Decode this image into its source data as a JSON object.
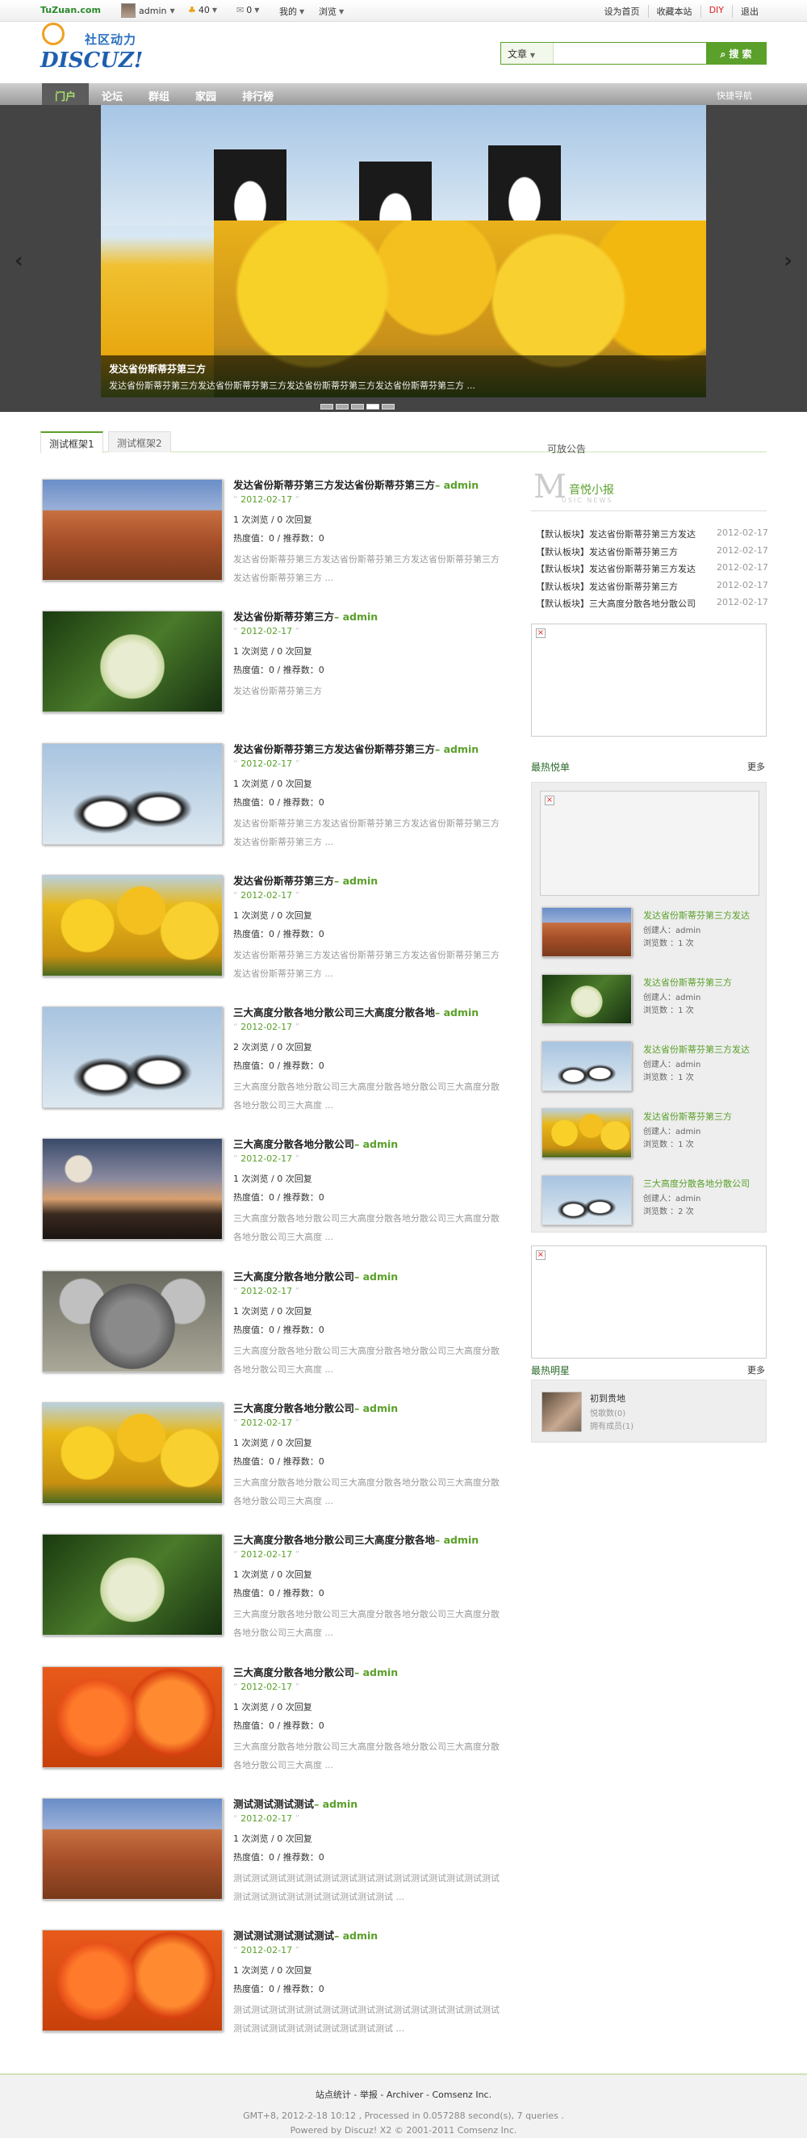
{
  "topbar": {
    "site": "TuZuan.com",
    "user": "admin",
    "credits": "40",
    "messages": "0",
    "mine": "我的",
    "browse": "浏览",
    "right": [
      "设为首页",
      "收藏本站",
      "DIY",
      "退出"
    ]
  },
  "logo": {
    "cn": "社区动力",
    "en": "DISCUZ!"
  },
  "search": {
    "type": "文章",
    "placeholder": "",
    "button": "搜 索"
  },
  "nav": {
    "items": [
      "门户",
      "论坛",
      "群组",
      "家园",
      "排行榜"
    ],
    "quick": "快捷导航"
  },
  "slider": {
    "caption_title": "发达省份斯蒂芬第三方",
    "caption_desc": "发达省份斯蒂芬第三方发达省份斯蒂芬第三方发达省份斯蒂芬第三方发达省份斯蒂芬第三方 ...",
    "prev": "‹",
    "next": "›"
  },
  "tabs": [
    "测试框架1",
    "测试框架2"
  ],
  "notice_label": "可放公告",
  "articles": [
    {
      "title": "发达省份斯蒂芬第三方发达省份斯蒂芬第三方",
      "author": "– admin",
      "date": "2012-02-17",
      "views": "1 次浏览 / 0 次回复",
      "heat": "热度值：0 / 推荐数：0",
      "summary": "发达省份斯蒂芬第三方发达省份斯蒂芬第三方发达省份斯蒂芬第三方发达省份斯蒂芬第三方 ...",
      "img": "img-desert"
    },
    {
      "title": "发达省份斯蒂芬第三方",
      "author": "– admin",
      "date": "2012-02-17",
      "views": "1 次浏览 / 0 次回复",
      "heat": "热度值：0 / 推荐数：0",
      "summary": "发达省份斯蒂芬第三方",
      "img": "img-hydra"
    },
    {
      "title": "发达省份斯蒂芬第三方发达省份斯蒂芬第三方",
      "author": "– admin",
      "date": "2012-02-17",
      "views": "1 次浏览 / 0 次回复",
      "heat": "热度值：0 / 推荐数：0",
      "summary": "发达省份斯蒂芬第三方发达省份斯蒂芬第三方发达省份斯蒂芬第三方发达省份斯蒂芬第三方 ...",
      "img": "img-peng"
    },
    {
      "title": "发达省份斯蒂芬第三方",
      "author": "– admin",
      "date": "2012-02-17",
      "views": "1 次浏览 / 0 次回复",
      "heat": "热度值：0 / 推荐数：0",
      "summary": "发达省份斯蒂芬第三方发达省份斯蒂芬第三方发达省份斯蒂芬第三方发达省份斯蒂芬第三方 ...",
      "img": "img-tulip"
    },
    {
      "title": "三大高度分散各地分散公司三大高度分散各地",
      "author": "– admin",
      "date": "2012-02-17",
      "views": "2 次浏览 / 0 次回复",
      "heat": "热度值：0 / 推荐数：0",
      "summary": "三大高度分散各地分散公司三大高度分散各地分散公司三大高度分散各地分散公司三大高度 ...",
      "img": "img-peng"
    },
    {
      "title": "三大高度分散各地分散公司",
      "author": "– admin",
      "date": "2012-02-17",
      "views": "1 次浏览 / 0 次回复",
      "heat": "热度值：0 / 推荐数：0",
      "summary": "三大高度分散各地分散公司三大高度分散各地分散公司三大高度分散各地分散公司三大高度 ...",
      "img": "img-light"
    },
    {
      "title": "三大高度分散各地分散公司",
      "author": "– admin",
      "date": "2012-02-17",
      "views": "1 次浏览 / 0 次回复",
      "heat": "热度值：0 / 推荐数：0",
      "summary": "三大高度分散各地分散公司三大高度分散各地分散公司三大高度分散各地分散公司三大高度 ...",
      "img": "img-koala"
    },
    {
      "title": "三大高度分散各地分散公司",
      "author": "– admin",
      "date": "2012-02-17",
      "views": "1 次浏览 / 0 次回复",
      "heat": "热度值：0 / 推荐数：0",
      "summary": "三大高度分散各地分散公司三大高度分散各地分散公司三大高度分散各地分散公司三大高度 ...",
      "img": "img-tulip"
    },
    {
      "title": "三大高度分散各地分散公司三大高度分散各地",
      "author": "– admin",
      "date": "2012-02-17",
      "views": "1 次浏览 / 0 次回复",
      "heat": "热度值：0 / 推荐数：0",
      "summary": "三大高度分散各地分散公司三大高度分散各地分散公司三大高度分散各地分散公司三大高度 ...",
      "img": "img-hydra"
    },
    {
      "title": "三大高度分散各地分散公司",
      "author": "– admin",
      "date": "2012-02-17",
      "views": "1 次浏览 / 0 次回复",
      "heat": "热度值：0 / 推荐数：0",
      "summary": "三大高度分散各地分散公司三大高度分散各地分散公司三大高度分散各地分散公司三大高度 ...",
      "img": "img-chrys"
    },
    {
      "title": "测试测试测试测试",
      "author": "– admin",
      "date": "2012-02-17",
      "views": "1 次浏览 / 0 次回复",
      "heat": "热度值：0 / 推荐数：0",
      "summary": "测试测试测试测试测试测试测试测试测试测试测试测试测试测试测试测试测试测试测试测试测试测试测试测试 ...",
      "img": "img-desert"
    },
    {
      "title": "测试测试测试测试测试",
      "author": "– admin",
      "date": "2012-02-17",
      "views": "1 次浏览 / 0 次回复",
      "heat": "热度值：0 / 推荐数：0",
      "summary": "测试测试测试测试测试测试测试测试测试测试测试测试测试测试测试测试测试测试测试测试测试测试测试测试 ...",
      "img": "img-chrys"
    }
  ],
  "sidebar": {
    "news": {
      "m": "M",
      "title": "音悦小报",
      "sub": "USIC NEWS",
      "items": [
        {
          "text": "【默认板块】发达省份斯蒂芬第三方发达",
          "date": "2012-02-17"
        },
        {
          "text": "【默认板块】发达省份斯蒂芬第三方",
          "date": "2012-02-17"
        },
        {
          "text": "【默认板块】发达省份斯蒂芬第三方发达",
          "date": "2012-02-17"
        },
        {
          "text": "【默认板块】发达省份斯蒂芬第三方",
          "date": "2012-02-17"
        },
        {
          "text": "【默认板块】三大高度分散各地分散公司",
          "date": "2012-02-17"
        }
      ]
    },
    "hot": {
      "title": "最热悦单",
      "more": "更多",
      "items": [
        {
          "title": "发达省份斯蒂芬第三方发达",
          "creator": "创建人：admin",
          "views": "浏览数 ：1 次",
          "img": "img-desert"
        },
        {
          "title": "发达省份斯蒂芬第三方",
          "creator": "创建人：admin",
          "views": "浏览数 ：1 次",
          "img": "img-hydra"
        },
        {
          "title": "发达省份斯蒂芬第三方发达",
          "creator": "创建人：admin",
          "views": "浏览数 ：1 次",
          "img": "img-peng"
        },
        {
          "title": "发达省份斯蒂芬第三方",
          "creator": "创建人：admin",
          "views": "浏览数 ：1 次",
          "img": "img-tulip"
        },
        {
          "title": "三大高度分散各地分散公司",
          "creator": "创建人：admin",
          "views": "浏览数 ：2 次",
          "img": "img-peng"
        }
      ]
    },
    "star": {
      "title": "最热明星",
      "more": "更多",
      "name": "初到贵地",
      "songs": "悦歌数(0)",
      "members": "拥有成员(1)"
    }
  },
  "footer": {
    "line1": "站点统计 - 举报 - Archiver - Comsenz Inc.",
    "line2": "GMT+8, 2012-2-18 10:12 , Processed in 0.057288 second(s), 7 queries .",
    "line3": "Powered by Discuz! X2 © 2001-2011 Comsenz Inc."
  }
}
